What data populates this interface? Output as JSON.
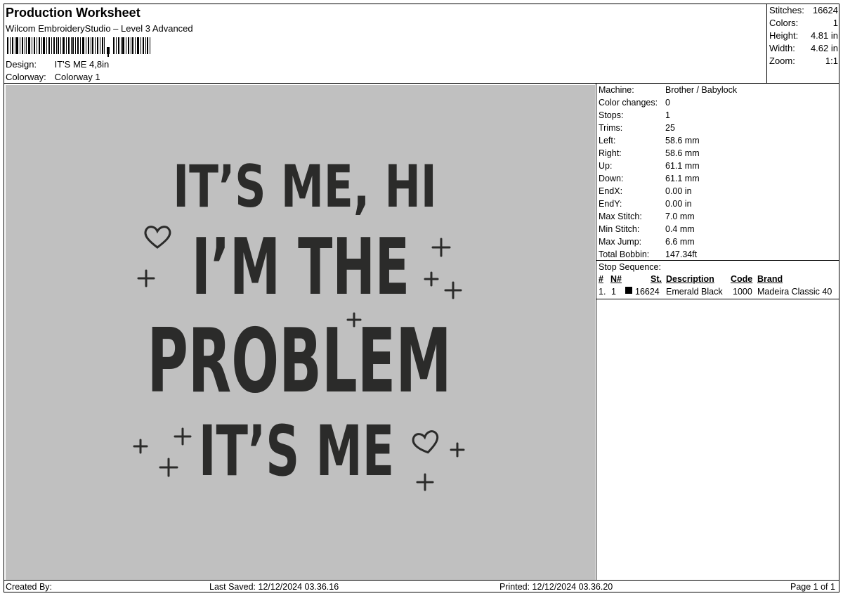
{
  "header": {
    "title": "Production Worksheet",
    "software": "Wilcom EmbroideryStudio – Level 3 Advanced",
    "design_label": "Design:",
    "design_value": "IT'S ME 4,8in",
    "colorway_label": "Colorway:",
    "colorway_value": "Colorway 1"
  },
  "stats": {
    "stitches_label": "Stitches:",
    "stitches_value": "16624",
    "colors_label": "Colors:",
    "colors_value": "1",
    "height_label": "Height:",
    "height_value": "4.81 in",
    "width_label": "Width:",
    "width_value": "4.62 in",
    "zoom_label": "Zoom:",
    "zoom_value": "1:1"
  },
  "design_preview": {
    "lines": [
      "IT’S ME, HI",
      "I’M THE",
      "PROBLEM",
      "IT’S ME"
    ],
    "thread_color": "#2b2b2a",
    "background_color": "#c0c0c0"
  },
  "machine_info": [
    {
      "label": "Machine:",
      "value": "Brother / Babylock"
    },
    {
      "label": "Color changes:",
      "value": "0"
    },
    {
      "label": "Stops:",
      "value": "1"
    },
    {
      "label": "Trims:",
      "value": "25"
    },
    {
      "label": "Left:",
      "value": "58.6 mm"
    },
    {
      "label": "Right:",
      "value": "58.6 mm"
    },
    {
      "label": "Up:",
      "value": "61.1 mm"
    },
    {
      "label": "Down:",
      "value": "61.1 mm"
    },
    {
      "label": "EndX:",
      "value": "0.00 in"
    },
    {
      "label": "EndY:",
      "value": "0.00 in"
    },
    {
      "label": "Max Stitch:",
      "value": "7.0 mm"
    },
    {
      "label": "Min Stitch:",
      "value": "0.4 mm"
    },
    {
      "label": "Max Jump:",
      "value": "6.6 mm"
    },
    {
      "label": "Total Bobbin:",
      "value": "147.34ft"
    }
  ],
  "stop_sequence": {
    "title": "Stop Sequence:",
    "headers": {
      "num": "#",
      "n": "N#",
      "st": "St.",
      "description": "Description",
      "code": "Code",
      "brand": "Brand"
    },
    "rows": [
      {
        "num": "1.",
        "n": "1",
        "swatch_color": "#000000",
        "st": "16624",
        "description": "Emerald Black",
        "code": "1000",
        "brand": "Madeira Classic 40"
      }
    ]
  },
  "footer": {
    "created_by": "Created By:",
    "last_saved": "Last Saved: 12/12/2024 03.36.16",
    "printed": "Printed: 12/12/2024 03.36.20",
    "page": "Page 1 of 1"
  }
}
